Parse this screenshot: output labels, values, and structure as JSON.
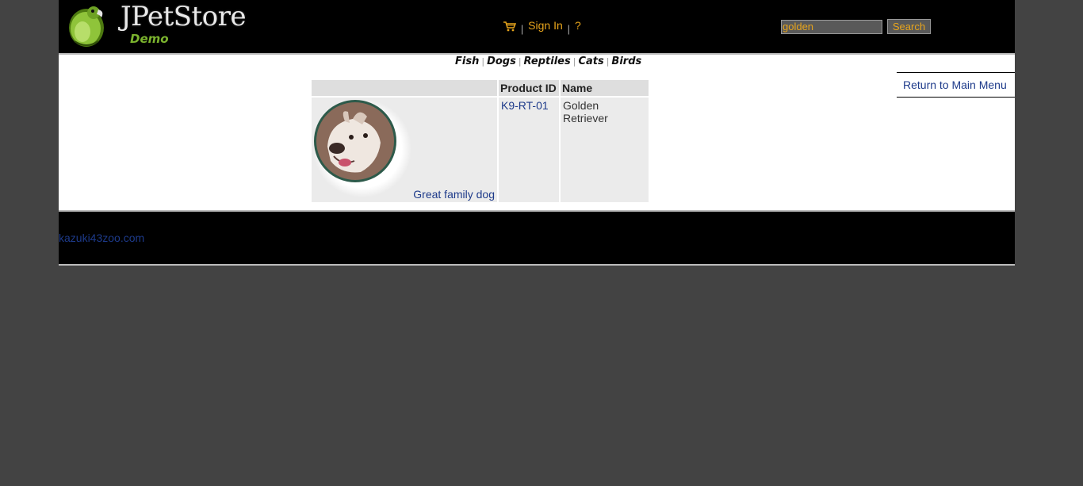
{
  "header": {
    "logo_title": "JPetStore",
    "logo_subtitle": "Demo",
    "menu": {
      "sign_in_label": "Sign In",
      "help_label": "?",
      "separator": "|"
    },
    "search": {
      "value": "golden",
      "button_label": "Search"
    }
  },
  "quicklinks": [
    {
      "label": "Fish"
    },
    {
      "label": "Dogs"
    },
    {
      "label": "Reptiles"
    },
    {
      "label": "Cats"
    },
    {
      "label": "Birds"
    }
  ],
  "back_link": {
    "label": "Return to Main Menu"
  },
  "table": {
    "headers": [
      "",
      "Product ID",
      "Name"
    ],
    "rows": [
      {
        "description": "Great family dog",
        "product_id": "K9-RT-01",
        "name": "Golden Retriever"
      }
    ]
  },
  "footer": {
    "link_label": "kazuki43zoo.com"
  },
  "colors": {
    "page_bg": "#434343",
    "accent": "#e8a51c",
    "link": "#1d3a8a",
    "logo_green": "#7bb32e"
  }
}
